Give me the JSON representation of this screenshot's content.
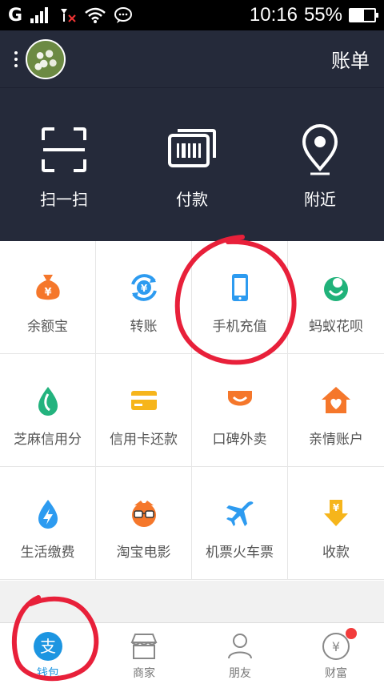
{
  "status_bar": {
    "network": "G",
    "time": "10:16",
    "battery_percent": "55%",
    "battery_level": 0.55
  },
  "header": {
    "bill_label": "账单"
  },
  "actions": [
    {
      "label": "扫一扫",
      "icon": "scan-icon"
    },
    {
      "label": "付款",
      "icon": "barcode-payment-icon"
    },
    {
      "label": "附近",
      "icon": "location-pin-icon"
    }
  ],
  "grid": [
    {
      "label": "余额宝",
      "icon": "money-bag-icon",
      "color": "#f5772b"
    },
    {
      "label": "转账",
      "icon": "transfer-yuan-icon",
      "color": "#2d9bf0"
    },
    {
      "label": "手机充值",
      "icon": "mobile-phone-icon",
      "color": "#2d9bf0"
    },
    {
      "label": "蚂蚁花呗",
      "icon": "flower-icon",
      "color": "#20b27a"
    },
    {
      "label": "芝麻信用分",
      "icon": "sesame-drop-icon",
      "color": "#23b37e"
    },
    {
      "label": "信用卡还款",
      "icon": "credit-card-icon",
      "color": "#f6b51b"
    },
    {
      "label": "口碑外卖",
      "icon": "smile-icon",
      "color": "#f5772b"
    },
    {
      "label": "亲情账户",
      "icon": "heart-house-icon",
      "color": "#f5772b"
    },
    {
      "label": "生活缴费",
      "icon": "lightning-drop-icon",
      "color": "#2d9bf0"
    },
    {
      "label": "淘宝电影",
      "icon": "glasses-face-icon",
      "color": "#f5772b"
    },
    {
      "label": "机票火车票",
      "icon": "airplane-icon",
      "color": "#2d9bf0"
    },
    {
      "label": "收款",
      "icon": "receive-money-icon",
      "color": "#f6b51b"
    }
  ],
  "tabs": [
    {
      "label": "钱包",
      "icon": "alipay-icon",
      "active": true
    },
    {
      "label": "商家",
      "icon": "shop-icon",
      "active": false
    },
    {
      "label": "朋友",
      "icon": "friends-icon",
      "active": false
    },
    {
      "label": "财富",
      "icon": "wealth-icon",
      "active": false
    }
  ],
  "colors": {
    "header_bg": "#252a3a",
    "accent": "#1c95e1",
    "annotation": "#e8203a"
  }
}
